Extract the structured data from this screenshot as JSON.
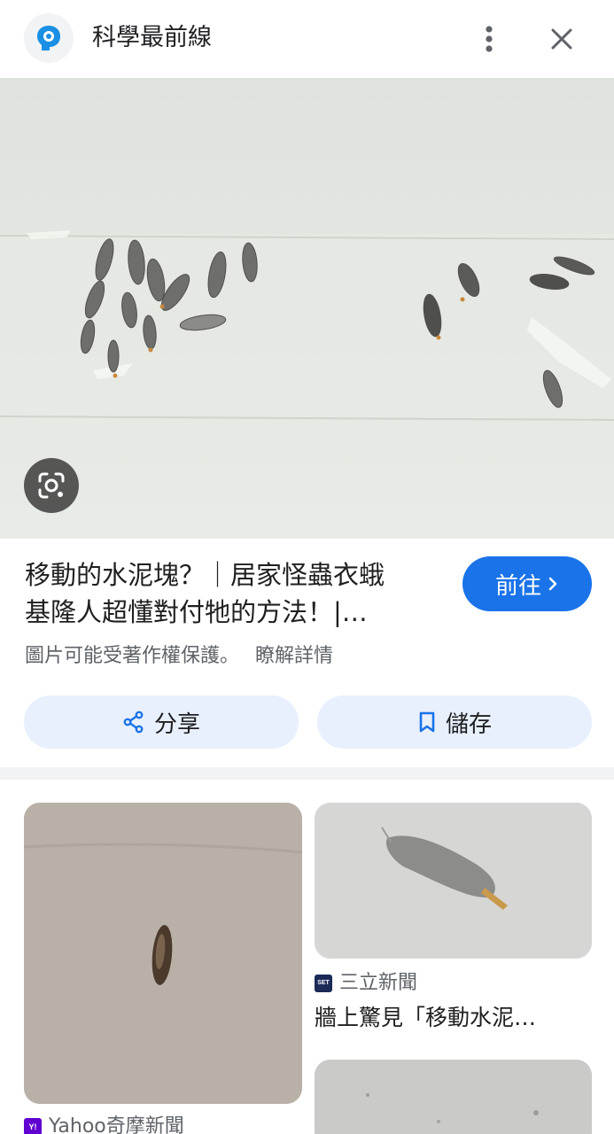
{
  "header": {
    "source_name": "科學最前線",
    "more_icon": "more-vert-icon",
    "close_icon": "close-icon"
  },
  "hero": {
    "lens_icon": "google-lens-icon"
  },
  "result": {
    "title_line1": "移動的水泥塊？｜居家怪蟲衣蛾",
    "title_line2": "基隆人超懂對付牠的方法！|…",
    "visit_label": "前往",
    "copyright_text": "圖片可能受著作權保護。",
    "learn_more": "瞭解詳情",
    "share_label": "分享",
    "save_label": "儲存"
  },
  "related": [
    {
      "source": "Yahoo奇摩新聞",
      "favicon": "Y!",
      "favicon_color": "#6001d2"
    },
    {
      "source": "三立新聞",
      "favicon": "SET",
      "favicon_color": "#1b2a57",
      "title": "牆上驚見「移動水泥…"
    },
    {
      "source": "",
      "title": ""
    }
  ],
  "colors": {
    "accent": "#1a73e8",
    "button_tonal": "#e8f0fe",
    "text_secondary": "#5f6368"
  }
}
